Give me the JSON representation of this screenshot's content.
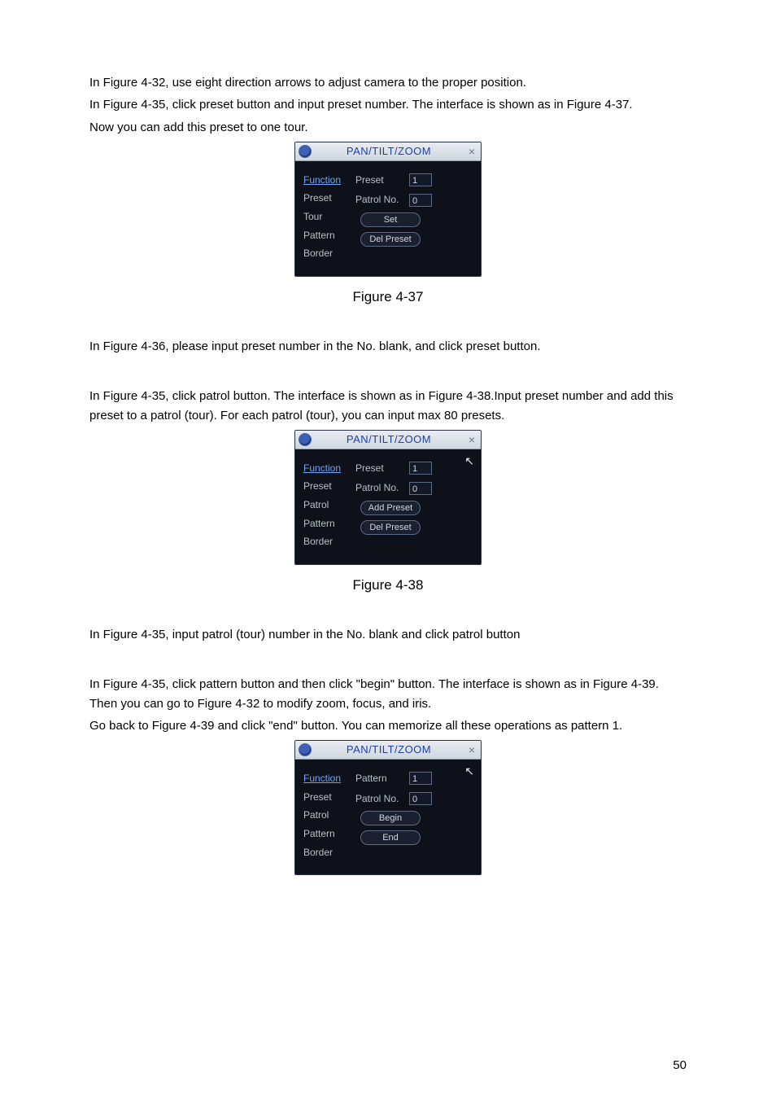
{
  "paragraphs": {
    "p1": "In Figure 4-32, use eight direction arrows to adjust camera to the proper position.",
    "p2": "In Figure 4-35, click preset button and input preset number. The interface is shown as in Figure 4-37.",
    "p3": "Now you can add this preset to one tour.",
    "p4": "In Figure 4-36, please input preset number in the No. blank, and click preset button.",
    "p5": "In Figure 4-35, click patrol button. The interface is shown as in Figure 4-38.Input preset number and add this preset to a patrol (tour). For each patrol (tour), you can input max 80 presets.",
    "p6": "In Figure 4-35, input patrol (tour) number in the No. blank and click patrol button",
    "p7": "In Figure 4-35, click pattern button and then click \"begin\" button. The interface is shown as in Figure 4-39. Then you can go to Figure 4-32 to modify zoom, focus, and iris.",
    "p8": "Go back to Figure 4-39 and click \"end\" button. You can memorize all these operations as pattern 1."
  },
  "captions": {
    "fig37": "Figure 4-37",
    "fig38": "Figure 4-38"
  },
  "dialogs": {
    "title": "PAN/TILT/ZOOM",
    "close_glyph": "×",
    "cursor_glyph": "↖",
    "d37": {
      "menu": [
        "Function",
        "Preset",
        "Tour",
        "Pattern",
        "Border"
      ],
      "active_index": 0,
      "rows": [
        {
          "label": "Preset",
          "value": "1"
        },
        {
          "label": "Patrol No.",
          "value": "0"
        }
      ],
      "buttons": [
        "Set",
        "Del Preset"
      ],
      "show_cursor": false
    },
    "d38": {
      "menu": [
        "Function",
        "Preset",
        "Patrol",
        "Pattern",
        "Border"
      ],
      "active_index": 0,
      "rows": [
        {
          "label": "Preset",
          "value": "1"
        },
        {
          "label": "Patrol No.",
          "value": "0"
        }
      ],
      "buttons": [
        "Add Preset",
        "Del Preset"
      ],
      "show_cursor": true
    },
    "d39": {
      "menu": [
        "Function",
        "Preset",
        "Patrol",
        "Pattern",
        "Border"
      ],
      "active_index": 0,
      "rows": [
        {
          "label": "Pattern",
          "value": "1"
        },
        {
          "label": "Patrol No.",
          "value": "0"
        }
      ],
      "buttons": [
        "Begin",
        "End"
      ],
      "show_cursor": true
    }
  },
  "page_number": "50"
}
